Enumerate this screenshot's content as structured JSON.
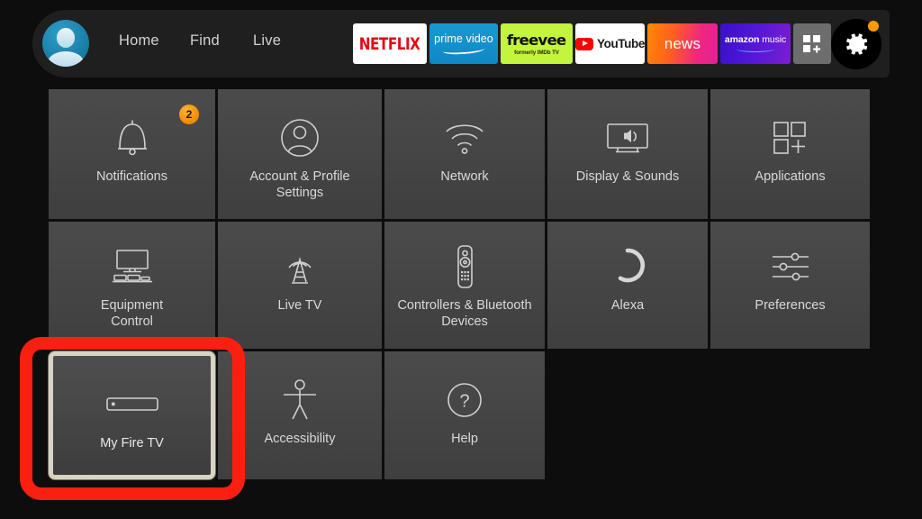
{
  "header": {
    "avatar_name": "user-profile-avatar",
    "nav": [
      {
        "id": "home",
        "label": "Home"
      },
      {
        "id": "find",
        "label": "Find"
      },
      {
        "id": "live",
        "label": "Live"
      }
    ],
    "apps": [
      {
        "id": "netflix",
        "label": "NETFLIX",
        "bg": "#ffffff"
      },
      {
        "id": "prime-video",
        "label": "prime video",
        "bg": "#11a0d4"
      },
      {
        "id": "freevee",
        "label": "freevee",
        "sub": "formerly IMDb TV",
        "bg": "#c3f53c"
      },
      {
        "id": "youtube",
        "label": "YouTube",
        "bg": "#ffffff"
      },
      {
        "id": "news",
        "label": "news",
        "bg": "#ff6a1f"
      },
      {
        "id": "amazon-music",
        "label_bold": "amazon",
        "label_light": " music",
        "bg": "#4e14d0"
      }
    ],
    "app_grid_label": "app-library",
    "settings_gear": {
      "label": "Settings",
      "badge_visible": true,
      "badge_color": "#ff9900"
    }
  },
  "grid": {
    "rows": [
      {
        "tiles": [
          {
            "id": "notifications",
            "label": "Notifications",
            "icon": "bell-icon",
            "badge": "2",
            "focused": false
          },
          {
            "id": "account-profile-settings",
            "label": "Account & Profile\nSettings",
            "label_line1": "Account & Profile",
            "label_line2": "Settings",
            "icon": "person-circle-icon",
            "focused": false
          },
          {
            "id": "network",
            "label": "Network",
            "icon": "wifi-icon",
            "focused": false
          },
          {
            "id": "display-sounds",
            "label": "Display & Sounds",
            "icon": "tv-speaker-icon",
            "focused": false
          },
          {
            "id": "applications",
            "label": "Applications",
            "icon": "app-squares-plus-icon",
            "focused": false
          }
        ]
      },
      {
        "tiles": [
          {
            "id": "equipment-control",
            "label_line1": "Equipment",
            "label_line2": "Control",
            "icon": "tv-equipment-icon",
            "focused": false
          },
          {
            "id": "live-tv",
            "label": "Live TV",
            "icon": "antenna-tower-icon",
            "focused": false
          },
          {
            "id": "controllers-bluetooth-devices",
            "label_line1": "Controllers & Bluetooth",
            "label_line2": "Devices",
            "icon": "remote-control-icon",
            "focused": false
          },
          {
            "id": "alexa",
            "label": "Alexa",
            "icon": "alexa-ring-icon",
            "focused": false
          },
          {
            "id": "preferences",
            "label": "Preferences",
            "icon": "sliders-icon",
            "focused": false
          }
        ]
      },
      {
        "tiles": [
          {
            "id": "my-fire-tv",
            "label": "My Fire TV",
            "icon": "fire-tv-stick-icon",
            "focused": true
          },
          {
            "id": "accessibility",
            "label": "Accessibility",
            "icon": "accessibility-person-icon",
            "focused": false
          },
          {
            "id": "help",
            "label": "Help",
            "icon": "question-circle-icon",
            "focused": false
          }
        ]
      }
    ]
  },
  "annotation": {
    "target": "my-fire-tv",
    "shape": "rounded-rectangle",
    "color": "#fb1f12"
  },
  "colors": {
    "background": "#0d0d0d",
    "header_bar": "#1f1f1f",
    "tile": "#464646",
    "tile_text": "#d9d9d9",
    "focus_border": "#d9d3c4",
    "accent_orange": "#ff9900",
    "annotation_red": "#fb1f12"
  }
}
